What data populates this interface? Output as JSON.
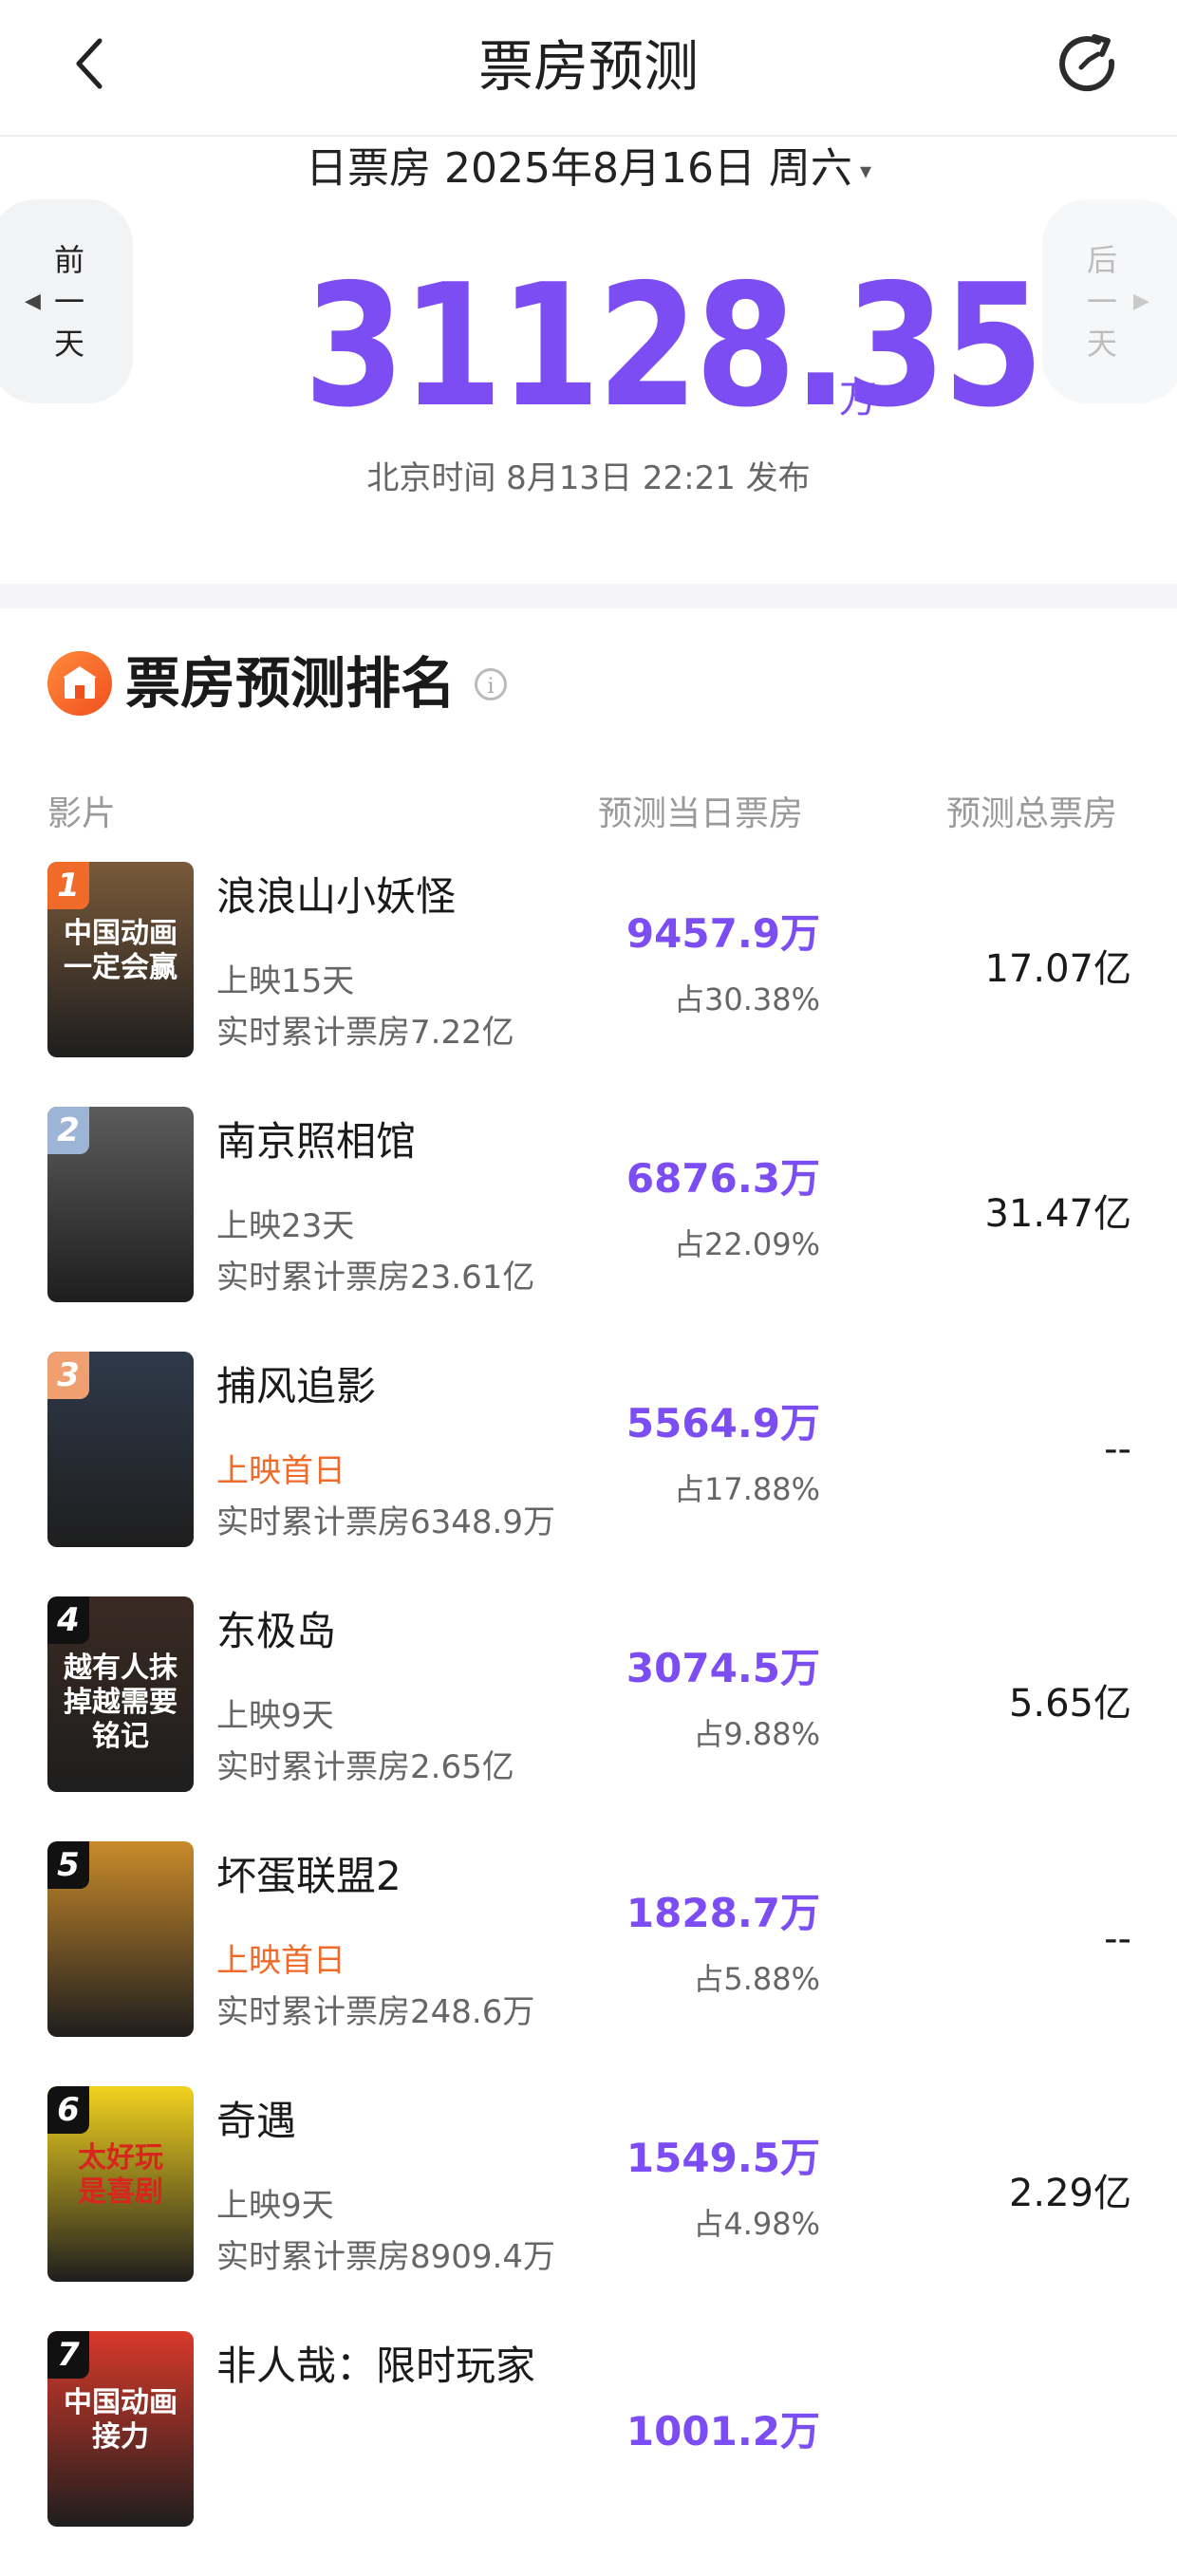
{
  "header": {
    "title": "票房预测"
  },
  "date_selector": {
    "label": "日票房 2025年8月16日 周六",
    "caret": "▾"
  },
  "nav": {
    "prev_day": [
      "前",
      "一",
      "天"
    ],
    "next_day": [
      "后",
      "一",
      "天"
    ],
    "prev_arrow": "◀",
    "next_arrow": "▶"
  },
  "summary": {
    "total": "31128.35",
    "unit": "万",
    "publish_time": "北京时间 8月13日 22:21 发布"
  },
  "ranking": {
    "title": "票房预测排名",
    "info": "i",
    "columns": {
      "film": "影片",
      "daily": "预测当日票房",
      "total": "预测总票房"
    },
    "films": [
      {
        "rank": "1",
        "name": "浪浪山小妖怪",
        "days": "上映15天",
        "first_day": false,
        "cumulative": "实时累计票房7.22亿",
        "daily": "9457.9万",
        "share": "占30.38%",
        "total": "17.07亿",
        "poster_text": "中国动画一定会赢",
        "poster_color": "#7a5a3a",
        "badge_color": "#f06a2a"
      },
      {
        "rank": "2",
        "name": "南京照相馆",
        "days": "上映23天",
        "first_day": false,
        "cumulative": "实时累计票房23.61亿",
        "daily": "6876.3万",
        "share": "占22.09%",
        "total": "31.47亿",
        "poster_text": "",
        "poster_color": "#5c5c5c",
        "badge_color": "#9db4d6"
      },
      {
        "rank": "3",
        "name": "捕风追影",
        "days": "上映首日",
        "first_day": true,
        "cumulative": "实时累计票房6348.9万",
        "daily": "5564.9万",
        "share": "占17.88%",
        "total": "--",
        "poster_text": "",
        "poster_color": "#2e3a4a",
        "badge_color": "#f0a070"
      },
      {
        "rank": "4",
        "name": "东极岛",
        "days": "上映9天",
        "first_day": false,
        "cumulative": "实时累计票房2.65亿",
        "daily": "3074.5万",
        "share": "占9.88%",
        "total": "5.65亿",
        "poster_text": "越有人抹掉越需要铭记",
        "poster_color": "#3a2a22",
        "badge_color": "#111111"
      },
      {
        "rank": "5",
        "name": "坏蛋联盟2",
        "days": "上映首日",
        "first_day": true,
        "cumulative": "实时累计票房248.6万",
        "daily": "1828.7万",
        "share": "占5.88%",
        "total": "--",
        "poster_text": "",
        "poster_color": "#c98a2a",
        "badge_color": "#111111"
      },
      {
        "rank": "6",
        "name": "奇遇",
        "days": "上映9天",
        "first_day": false,
        "cumulative": "实时累计票房8909.4万",
        "daily": "1549.5万",
        "share": "占4.98%",
        "total": "2.29亿",
        "poster_text": "太好玩 是喜剧",
        "poster_color": "#f2d21e",
        "badge_color": "#111111"
      },
      {
        "rank": "7",
        "name": "非人哉：限时玩家",
        "days": "",
        "first_day": false,
        "cumulative": "",
        "daily": "1001.2万",
        "share": "",
        "total": "",
        "poster_text": "中国动画接力",
        "poster_color": "#d8392a",
        "badge_color": "#111111"
      }
    ]
  },
  "icons": {
    "back": "chevron-left-icon",
    "refresh": "refresh-icon",
    "section": "theater-icon",
    "info": "info-icon"
  }
}
